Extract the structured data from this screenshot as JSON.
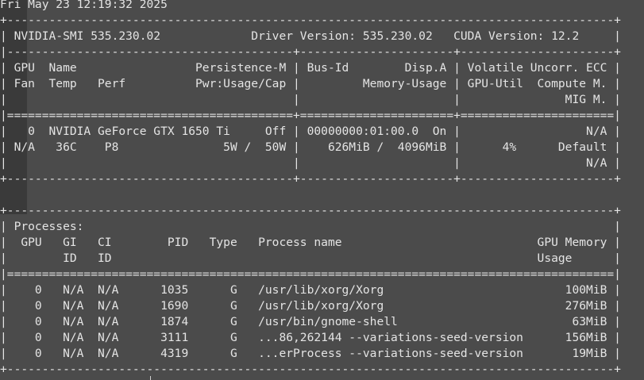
{
  "timestamp": "Fri May 23 12:19:32 2025",
  "lines": [
    "+---------------------------------------------------------------------------------------+",
    "| NVIDIA-SMI 535.230.02             Driver Version: 535.230.02   CUDA Version: 12.2     |",
    "|-----------------------------------------+----------------------+----------------------+",
    "| GPU  Name                 Persistence-M | Bus-Id        Disp.A | Volatile Uncorr. ECC |",
    "| Fan  Temp   Perf          Pwr:Usage/Cap |         Memory-Usage | GPU-Util  Compute M. |",
    "|                                         |                      |               MIG M. |",
    "|=========================================+======================+======================|",
    "|   0  NVIDIA GeForce GTX 1650 Ti     Off | 00000000:01:00.0  On |                  N/A |",
    "| N/A   36C    P8               5W /  50W |    626MiB /  4096MiB |      4%      Default |",
    "|                                         |                      |                  N/A |",
    "+-----------------------------------------+----------------------+----------------------+",
    "",
    "+---------------------------------------------------------------------------------------+",
    "| Processes:                                                                            |",
    "|  GPU   GI   CI        PID   Type   Process name                            GPU Memory |",
    "|        ID   ID                                                             Usage      |",
    "|=======================================================================================|",
    "|    0   N/A  N/A      1035      G   /usr/lib/xorg/Xorg                          100MiB |",
    "|    0   N/A  N/A      1690      G   /usr/lib/xorg/Xorg                          276MiB |",
    "|    0   N/A  N/A      1874      G   /usr/bin/gnome-shell                         63MiB |",
    "|    0   N/A  N/A      3111      G   ...86,262144 --variations-seed-version      156MiB |",
    "|    0   N/A  N/A      4319      G   ...erProcess --variations-seed-version       19MiB |",
    "+---------------------------------------------------------------------------------------+"
  ],
  "colors": {
    "background": "#4b4b4b",
    "text": "#e4e4e4"
  }
}
